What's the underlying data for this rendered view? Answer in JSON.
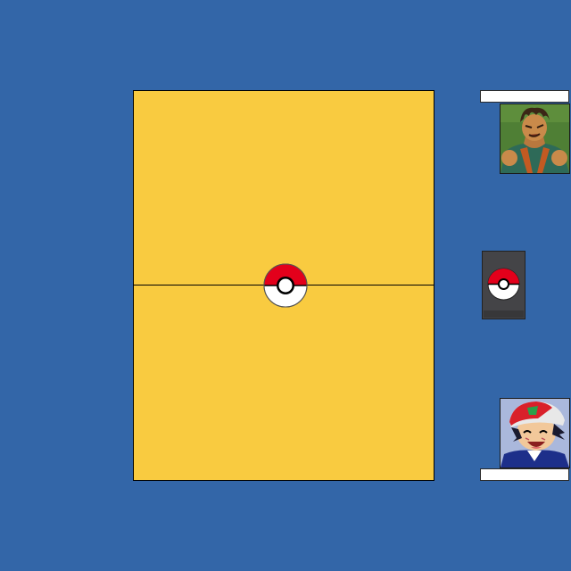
{
  "game": {
    "board": {
      "color": "#f9cb40",
      "center_icon": "pokeball-icon"
    },
    "opponent": {
      "name": "",
      "portrait": "opponent-trainer-portrait"
    },
    "player": {
      "name": "",
      "portrait": "player-trainer-portrait"
    },
    "deck": {
      "icon": "pokeball-icon"
    }
  },
  "colors": {
    "background": "#3366a8",
    "board": "#f9cb40",
    "pokeball_red": "#e3001b",
    "deck": "#444447"
  }
}
